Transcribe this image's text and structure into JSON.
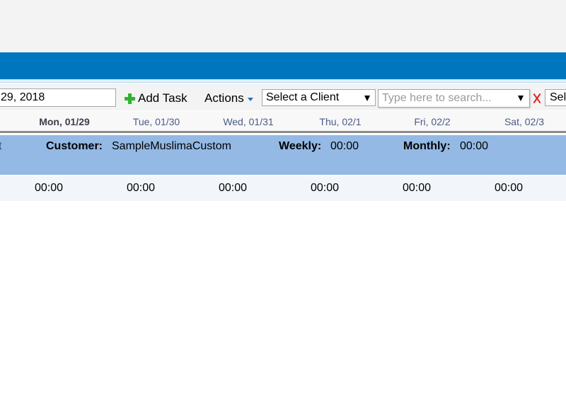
{
  "toolbar": {
    "date_value": "29, 2018",
    "add_task_label": "Add Task",
    "actions_label": "Actions",
    "client_select_value": "Select a Client",
    "search_placeholder": "Type here to search...",
    "select_fragment": "Sel"
  },
  "days": [
    "Mon, 01/29",
    "Tue, 01/30",
    "Wed, 01/31",
    "Thu, 02/1",
    "Fri, 02/2",
    "Sat, 02/3"
  ],
  "band": {
    "left_fragment": "t",
    "customer_label": "Customer:",
    "customer_value": "SampleMuslimaCustom",
    "weekly_label": "Weekly:",
    "weekly_value": "00:00",
    "monthly_label": "Monthly:",
    "monthly_value": "00:00"
  },
  "times": [
    "00:00",
    "00:00",
    "00:00",
    "00:00",
    "00:00",
    "00:00"
  ],
  "colors": {
    "header_blue": "#0076bf",
    "band_blue": "#94b9e5",
    "add_green": "#2db52d",
    "clear_red": "#e02020"
  },
  "icons": {
    "add": "plus-icon",
    "actions": "caret-down-icon",
    "clear": "clear-icon"
  }
}
